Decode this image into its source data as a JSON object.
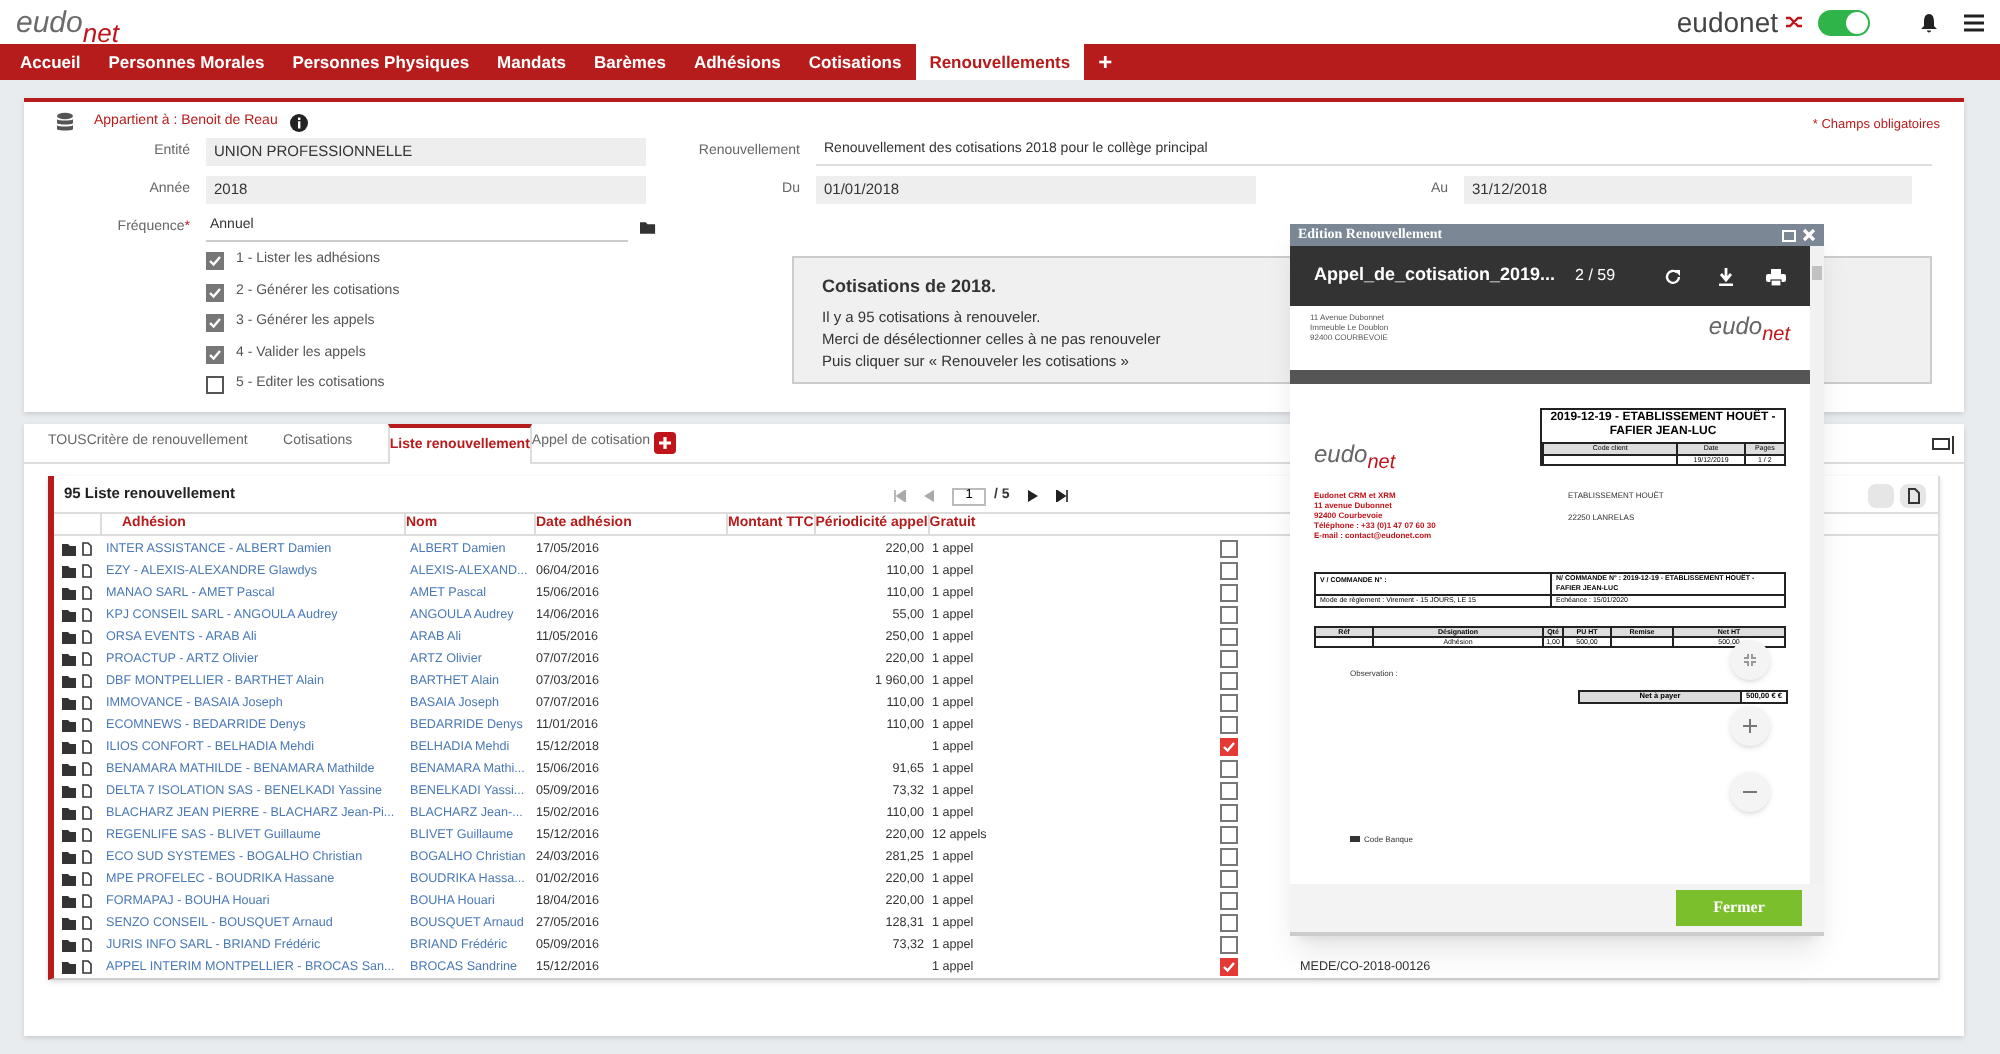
{
  "header": {
    "logo": {
      "top": "eudo",
      "bottom": "net"
    },
    "brand": "eudonet",
    "toggle": {
      "on": true
    }
  },
  "nav": [
    {
      "label": "Accueil",
      "selected": false
    },
    {
      "label": "Personnes Morales",
      "selected": false
    },
    {
      "label": "Personnes Physiques",
      "selected": false
    },
    {
      "label": "Mandats",
      "selected": false
    },
    {
      "label": "Barèmes",
      "selected": false
    },
    {
      "label": "Adhésions",
      "selected": false
    },
    {
      "label": "Cotisations",
      "selected": false
    },
    {
      "label": "Renouvellements",
      "selected": true
    },
    {
      "label": "+",
      "selected": false
    }
  ],
  "form": {
    "owner": "Appartient à : Benoit de Reau",
    "required_note": "* Champs obligatoires",
    "fields": [
      {
        "label": "Entité",
        "value": "UNION PROFESSIONNELLE"
      },
      {
        "label": "Année",
        "value": "2018"
      }
    ],
    "frequency": {
      "label": "Fréquence",
      "required_mark": "*",
      "value": "Annuel"
    },
    "renewal": {
      "label": "Renouvellement",
      "value": "Renouvellement des cotisations 2018 pour le collège principal"
    },
    "from": {
      "label": "Du",
      "value": "01/01/2018"
    },
    "to": {
      "label": "Au",
      "value": "31/12/2018"
    },
    "steps": [
      {
        "label": "1 - Lister les adhésions",
        "checked": true
      },
      {
        "label": "2 - Générer les cotisations",
        "checked": true
      },
      {
        "label": "3 - Générer les appels",
        "checked": true
      },
      {
        "label": "4 - Valider les appels",
        "checked": true
      },
      {
        "label": "5 - Editer les cotisations",
        "checked": false
      }
    ],
    "info": {
      "title": "Cotisations de 2018.",
      "lines": [
        "Il y a 95 cotisations à renouveler.",
        "Merci de désélectionner celles à ne pas renouveler",
        "Puis cliquer sur « Renouveler les cotisations »"
      ]
    }
  },
  "tabs": [
    {
      "label": "TOUS",
      "selected": false
    },
    {
      "label": "Critère de renouvellement",
      "selected": false
    },
    {
      "label": "Cotisations",
      "selected": false
    },
    {
      "label": "Liste renouvellement",
      "selected": true
    },
    {
      "label": "Appel de cotisation",
      "selected": false
    }
  ],
  "table": {
    "title": "95 Liste renouvellement",
    "pager": {
      "page": "1",
      "total": "/ 5"
    },
    "columns": [
      "Adhésion",
      "Nom",
      "Date adhésion",
      "Montant TTC",
      "Périodicité appel",
      "Gratuit"
    ],
    "rows": [
      {
        "adhesion": "INTER ASSISTANCE - ALBERT Damien",
        "nom": "ALBERT Damien",
        "date": "17/05/2016",
        "montant": "220,00",
        "periodicite": "1 appel",
        "gratuit": false
      },
      {
        "adhesion": "EZY - ALEXIS-ALEXANDRE Glawdys",
        "nom": "ALEXIS-ALEXAND...",
        "date": "06/04/2016",
        "montant": "110,00",
        "periodicite": "1 appel",
        "gratuit": false
      },
      {
        "adhesion": "MANAO SARL - AMET Pascal",
        "nom": "AMET Pascal",
        "date": "15/06/2016",
        "montant": "110,00",
        "periodicite": "1 appel",
        "gratuit": false
      },
      {
        "adhesion": "KPJ CONSEIL SARL - ANGOULA Audrey",
        "nom": "ANGOULA Audrey",
        "date": "14/06/2016",
        "montant": "55,00",
        "periodicite": "1 appel",
        "gratuit": false
      },
      {
        "adhesion": "ORSA EVENTS - ARAB Ali",
        "nom": "ARAB Ali",
        "date": "11/05/2016",
        "montant": "250,00",
        "periodicite": "1 appel",
        "gratuit": false
      },
      {
        "adhesion": "PROACTUP - ARTZ Olivier",
        "nom": "ARTZ Olivier",
        "date": "07/07/2016",
        "montant": "220,00",
        "periodicite": "1 appel",
        "gratuit": false
      },
      {
        "adhesion": "DBF MONTPELLIER - BARTHET Alain",
        "nom": "BARTHET Alain",
        "date": "07/03/2016",
        "montant": "1 960,00",
        "periodicite": "1 appel",
        "gratuit": false
      },
      {
        "adhesion": "IMMOVANCE - BASAIA Joseph",
        "nom": "BASAIA Joseph",
        "date": "07/07/2016",
        "montant": "110,00",
        "periodicite": "1 appel",
        "gratuit": false
      },
      {
        "adhesion": "ECOMNEWS - BEDARRIDE Denys",
        "nom": "BEDARRIDE Denys",
        "date": "11/01/2016",
        "montant": "110,00",
        "periodicite": "1 appel",
        "gratuit": false
      },
      {
        "adhesion": "ILIOS CONFORT - BELHADIA Mehdi",
        "nom": "BELHADIA Mehdi",
        "date": "15/12/2018",
        "periodicite": "1 appel",
        "gratuit": true
      },
      {
        "adhesion": "BENAMARA MATHILDE - BENAMARA Mathilde",
        "nom": "BENAMARA Mathi...",
        "date": "15/06/2016",
        "montant": "91,65",
        "periodicite": "1 appel",
        "gratuit": false
      },
      {
        "adhesion": "DELTA 7 ISOLATION SAS - BENELKADI Yassine",
        "nom": "BENELKADI Yassi...",
        "date": "05/09/2016",
        "montant": "73,32",
        "periodicite": "1 appel",
        "gratuit": false
      },
      {
        "adhesion": "BLACHARZ JEAN PIERRE - BLACHARZ Jean-Pi...",
        "nom": "BLACHARZ Jean-...",
        "date": "15/02/2016",
        "montant": "110,00",
        "periodicite": "1 appel",
        "gratuit": false
      },
      {
        "adhesion": "REGENLIFE SAS - BLIVET Guillaume",
        "nom": "BLIVET Guillaume",
        "date": "15/12/2016",
        "montant": "220,00",
        "periodicite": "12 appels",
        "gratuit": false
      },
      {
        "adhesion": "ECO SUD SYSTEMES - BOGALHO Christian",
        "nom": "BOGALHO Christian",
        "date": "24/03/2016",
        "montant": "281,25",
        "periodicite": "1 appel",
        "gratuit": false
      },
      {
        "adhesion": "MPE PROFELEC - BOUDRIKA Hassane",
        "nom": "BOUDRIKA Hassa...",
        "date": "01/02/2016",
        "montant": "220,00",
        "periodicite": "1 appel",
        "gratuit": false
      },
      {
        "adhesion": "FORMAPAJ - BOUHA Houari",
        "nom": "BOUHA Houari",
        "date": "18/04/2016",
        "montant": "220,00",
        "periodicite": "1 appel",
        "gratuit": false
      },
      {
        "adhesion": "SENZO CONSEIL - BOUSQUET Arnaud",
        "nom": "BOUSQUET Arnaud",
        "date": "27/05/2016",
        "montant": "128,31",
        "periodicite": "1 appel",
        "gratuit": false
      },
      {
        "adhesion": "JURIS INFO SARL - BRIAND Frédéric",
        "nom": "BRIAND Frédéric",
        "date": "05/09/2016",
        "montant": "73,32",
        "periodicite": "1 appel",
        "gratuit": false
      },
      {
        "adhesion": "APPEL INTERIM MONTPELLIER - BROCAS San...",
        "nom": "BROCAS Sandrine",
        "date": "15/12/2016",
        "periodicite": "1 appel",
        "gratuit": true,
        "column_7": "MEDE/CO-2018-00126"
      }
    ]
  },
  "modal": {
    "title": "Edition Renouvellement",
    "file": "Appel_de_cotisation_2019...",
    "page": "2 / 59",
    "document": {
      "address": [
        "11 Avenue Dubonnet",
        "Immeuble Le Doublon",
        "92400 COURBEVOIE"
      ],
      "page1_logo": {
        "top": "eudo",
        "bottom": "net"
      },
      "page2_logo": {
        "top": "eudo",
        "bottom": "net"
      },
      "doc_title": "2019-12-19 - ETABLISSEMENT HOUËT - FAFIER JEAN-LUC",
      "meta_labels": [
        "Code client",
        "Date",
        "Pages"
      ],
      "meta_values": {
        "date": "19/12/2019",
        "pages": "1 / 2"
      },
      "sender": [
        "Eudonet CRM et XRM",
        "11 avenue Dubonnet",
        "92400 Courbevoie",
        "Téléphone : +33 (0)1 47 07 60 30",
        "E-mail : contact@eudonet.com"
      ],
      "recipient": [
        "ETABLISSEMENT HOUËT",
        "22250 LANRELAS"
      ],
      "order": [
        "V / COMMANDE N° :",
        "N/ COMMANDE N° : 2019-12-19 - ETABLISSEMENT HOUËT - FAFIER JEAN-LUC",
        "Mode de règlement : Virement - 15 JOURS, LE 15",
        "Echéance : 15/01/2020"
      ],
      "lines_header": [
        "Réf",
        "Désignation",
        "Qté",
        "PU HT",
        "Remise",
        "Net HT"
      ],
      "lines_row": {
        "designation": "Adhésion",
        "qty": "1,00",
        "unit_price": "500,00",
        "net": "500,00"
      },
      "observation": "Observation :",
      "total_label": "Net à payer",
      "total": "500,00 € €",
      "bank": "Code Banque"
    },
    "button": "Fermer"
  }
}
